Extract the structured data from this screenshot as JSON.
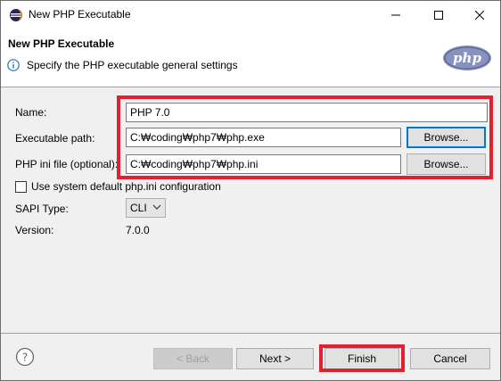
{
  "window": {
    "title": "New PHP Executable",
    "app_icon": "eclipse-icon"
  },
  "header": {
    "title": "New PHP Executable",
    "message": "Specify the PHP executable general settings",
    "logo_text": "php",
    "info_icon": "info-icon"
  },
  "form": {
    "name_label": "Name:",
    "name_value": "PHP 7.0",
    "exe_label": "Executable path:",
    "exe_value": "C:₩coding₩php7₩php.exe",
    "ini_label": "PHP ini file (optional):",
    "ini_value": "C:₩coding₩php7₩php.ini",
    "browse_label": "Browse...",
    "checkbox_label": "Use system default php.ini configuration",
    "sapi_label": "SAPI Type:",
    "sapi_value": "CLI",
    "version_label": "Version:",
    "version_value": "7.0.0"
  },
  "footer": {
    "back_label": "< Back",
    "next_label": "Next >",
    "finish_label": "Finish",
    "cancel_label": "Cancel"
  },
  "colors": {
    "highlight": "#e4202e",
    "focus": "#0078d7",
    "php_logo_bg": "#8892bf"
  }
}
